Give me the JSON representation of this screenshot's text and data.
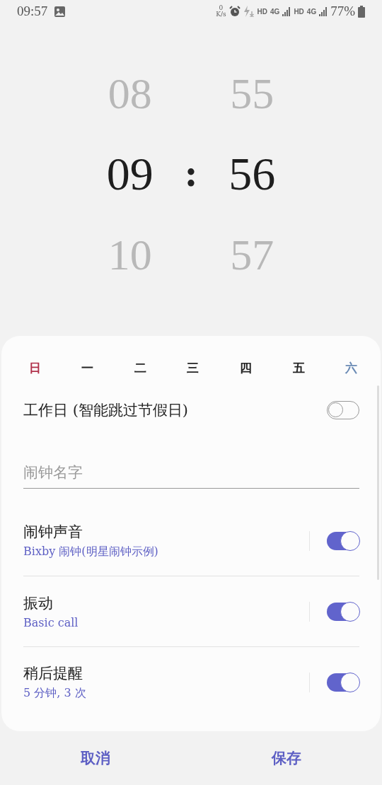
{
  "status_bar": {
    "time": "09:57",
    "speed_value": "0",
    "speed_unit": "K/s",
    "network_1": "HD",
    "type_1": "4G",
    "network_2": "HD",
    "type_2": "4G",
    "battery": "77%"
  },
  "picker": {
    "hours": [
      "08",
      "09",
      "10"
    ],
    "separator": ":",
    "minutes": [
      "55",
      "56",
      "57"
    ]
  },
  "days": [
    {
      "label": "日",
      "color": "#b0304a"
    },
    {
      "label": "一",
      "color": "#222222"
    },
    {
      "label": "二",
      "color": "#222222"
    },
    {
      "label": "三",
      "color": "#222222"
    },
    {
      "label": "四",
      "color": "#222222"
    },
    {
      "label": "五",
      "color": "#222222"
    },
    {
      "label": "六",
      "color": "#6b8bb5"
    }
  ],
  "workday": {
    "label": "工作日 (智能跳过节假日)",
    "on": false
  },
  "name_field": {
    "placeholder": "闹钟名字"
  },
  "settings": [
    {
      "title": "闹钟声音",
      "subtitle": "Bixby 闹钟(明星闹钟示例)",
      "on": true
    },
    {
      "title": "振动",
      "subtitle": "Basic call",
      "on": true
    },
    {
      "title": "稍后提醒",
      "subtitle": "5 分钟, 3 次",
      "on": true
    }
  ],
  "buttons": [
    "取消",
    "保存"
  ]
}
